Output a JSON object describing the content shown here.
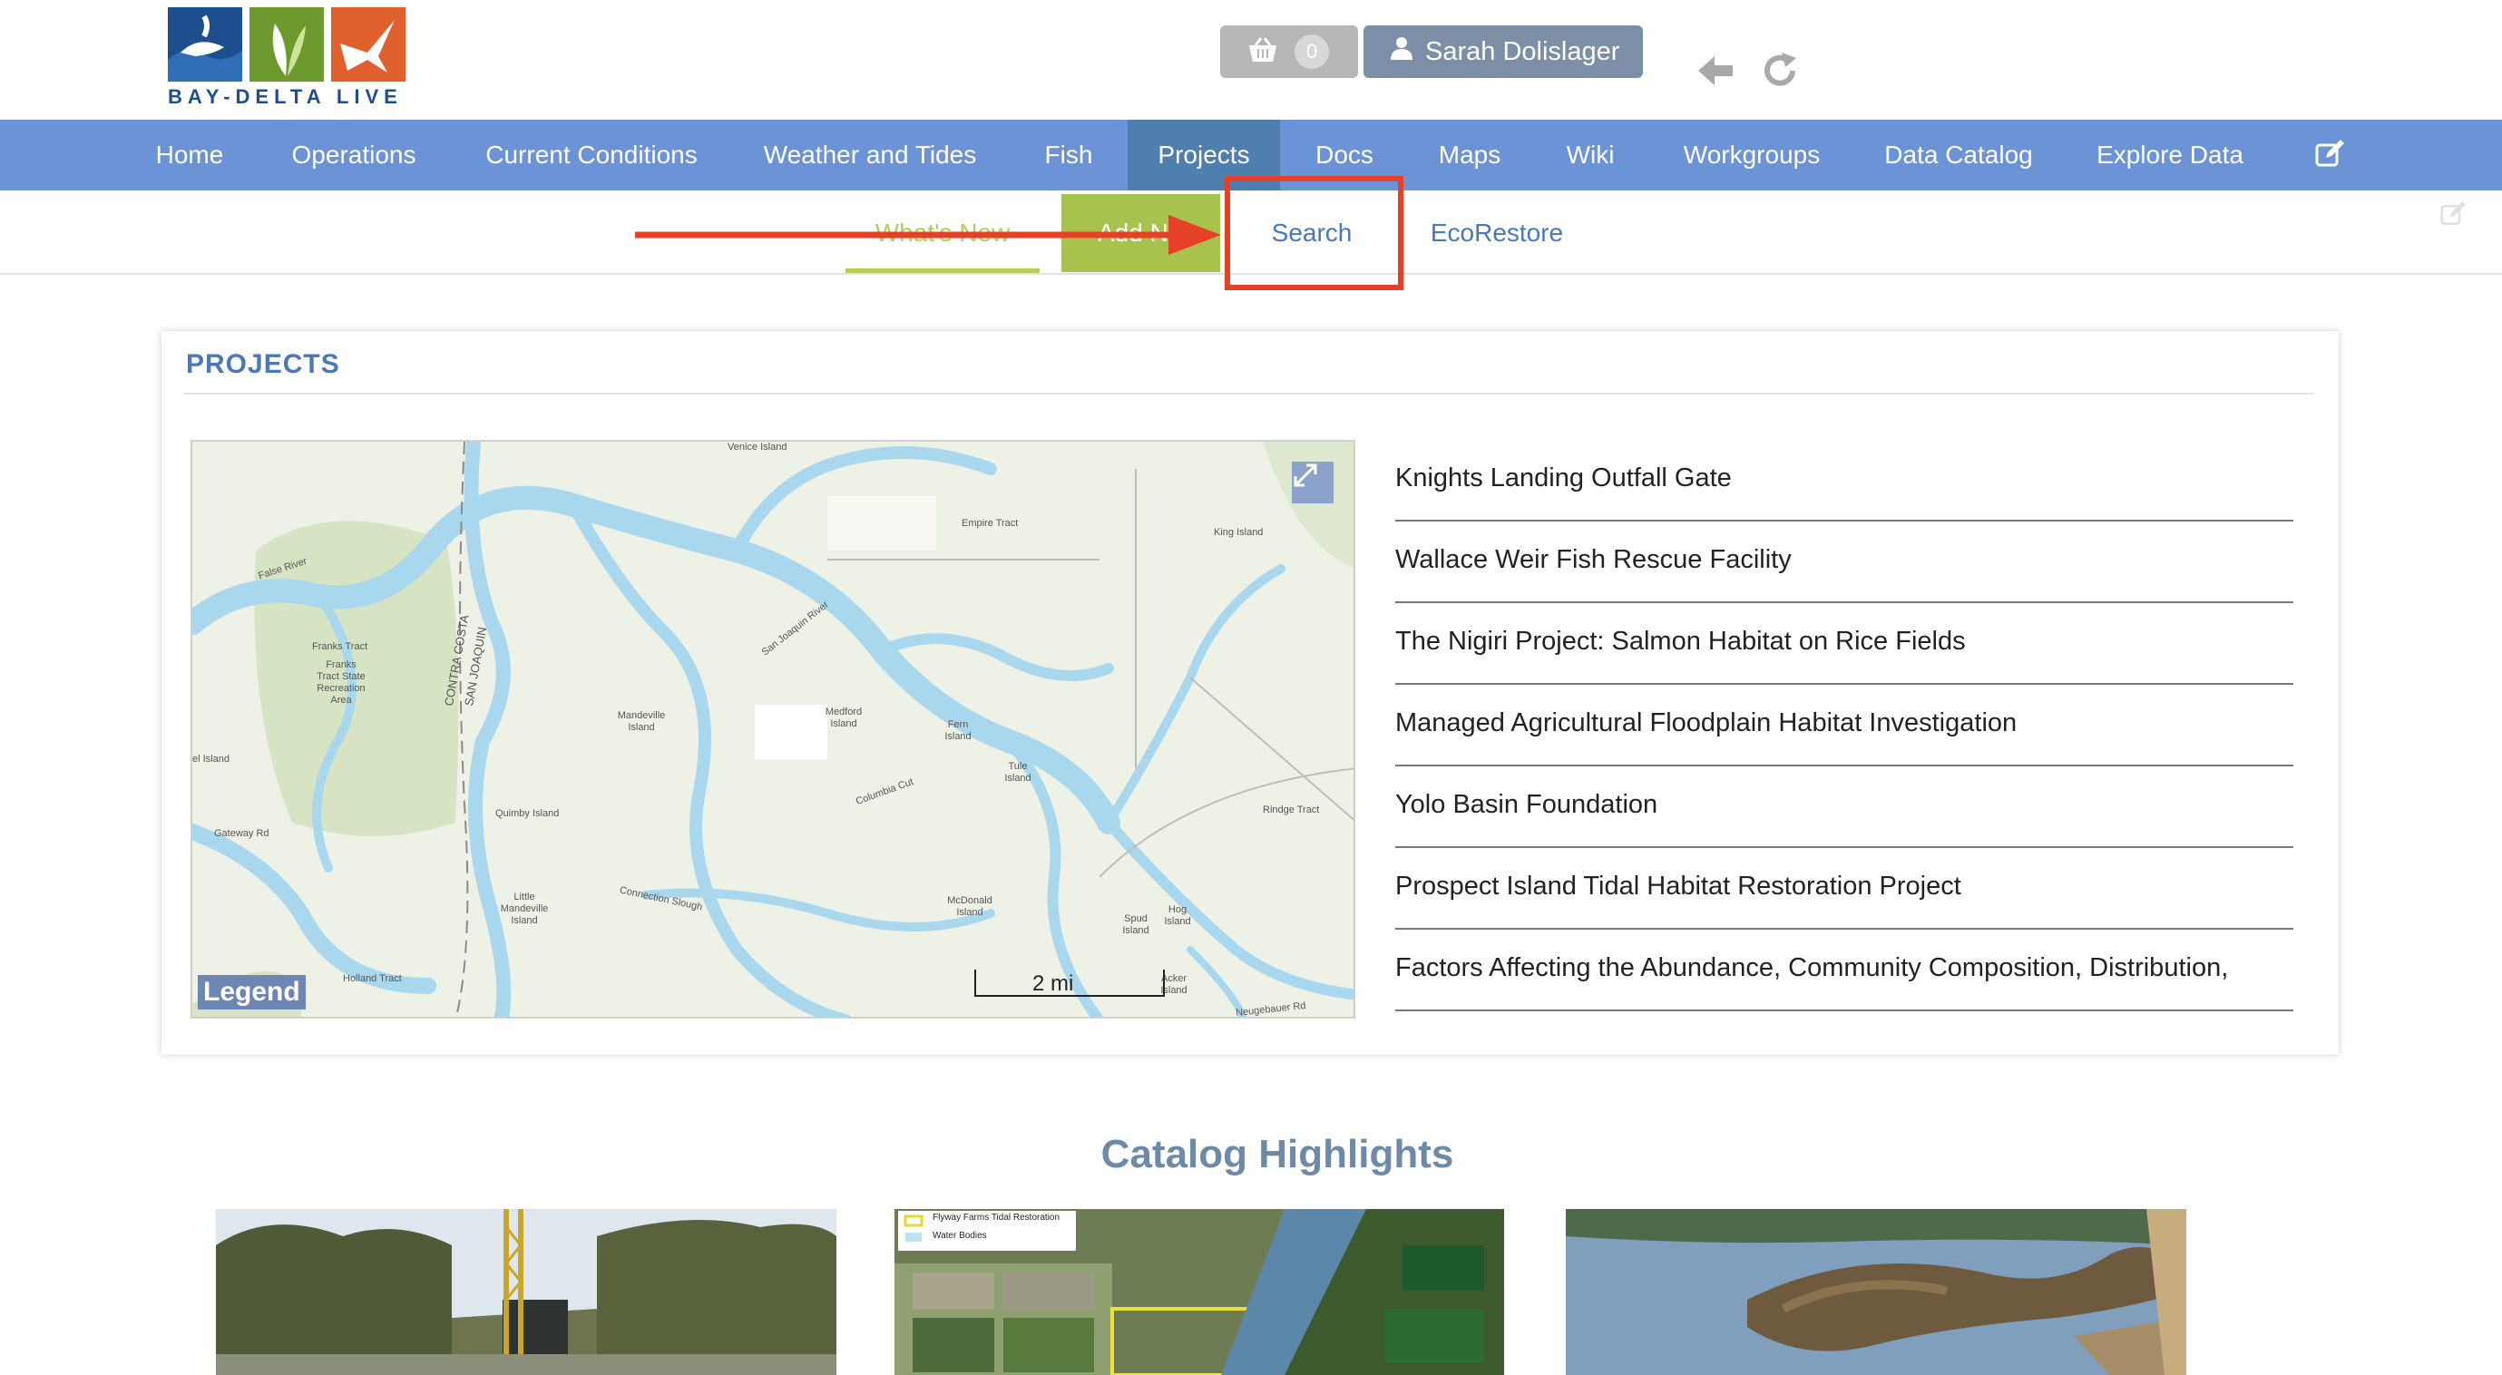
{
  "header": {
    "logo_text": "BAY-DELTA LIVE",
    "cart_count": "0",
    "user_name": "Sarah Dolislager",
    "icons": [
      "basket-icon",
      "user-icon",
      "back-arrow-icon",
      "refresh-icon"
    ]
  },
  "nav": {
    "items": [
      {
        "label": "Home"
      },
      {
        "label": "Operations"
      },
      {
        "label": "Current Conditions"
      },
      {
        "label": "Weather and Tides"
      },
      {
        "label": "Fish"
      },
      {
        "label": "Projects"
      },
      {
        "label": "Docs"
      },
      {
        "label": "Maps"
      },
      {
        "label": "Wiki"
      },
      {
        "label": "Workgroups"
      },
      {
        "label": "Data Catalog"
      },
      {
        "label": "Explore Data"
      }
    ],
    "active": "Projects",
    "accent_color": "#6b93d6"
  },
  "subnav": {
    "whats_new": "What's New",
    "add_new": "Add Ne",
    "search": "Search",
    "ecorestore": "EcoRestore"
  },
  "projects": {
    "title": "PROJECTS",
    "map": {
      "legend_label": "Legend",
      "scale_label": "2 mi",
      "labels": {
        "venice_island": "Venice Island",
        "empire_tract": "Empire Tract",
        "king_island": "King Island",
        "franks_tract": "Franks Tract",
        "franks_tract_sra": "Franks Tract State Recreation Area",
        "mandeville_island": "Mandeville Island",
        "medford_island": "Medford Island",
        "fern_island": "Fern Island",
        "tule_island": "Tule Island",
        "quimby_island": "Quimby Island",
        "little_mandeville": "Little Mandeville Island",
        "mcdonald_island": "McDonald Island",
        "spud_island": "Spud Island",
        "hog_island": "Hog Island",
        "rindge_tract": "Rindge Tract",
        "holland_tract": "Holland Tract",
        "bethel_island": "el Island",
        "gateway_rd": "Gateway Rd",
        "contra_costa": "CONTRA COSTA",
        "san_joaquin": "SAN JOAQUIN",
        "false_river": "False River",
        "san_joaquin_river": "San Joaquin River",
        "columbia_cut": "Columbia Cut",
        "connection_slough": "Connection Slough",
        "neugebauer_rd": "Neugebauer Rd",
        "acker_island": "Acker Island"
      }
    },
    "list": [
      "Knights Landing Outfall Gate",
      "Wallace Weir Fish Rescue Facility",
      "The Nigiri Project: Salmon Habitat on Rice Fields",
      "Managed Agricultural Floodplain Habitat Investigation",
      "Yolo Basin Foundation",
      "Prospect Island Tidal Habitat Restoration Project",
      "Factors Affecting the Abundance, Community Composition, Distribution,"
    ]
  },
  "catalog": {
    "title": "Catalog Highlights",
    "thumb2_legend_1": "Flyway Farms Tidal Restoration",
    "thumb2_legend_2": "Water Bodies"
  }
}
